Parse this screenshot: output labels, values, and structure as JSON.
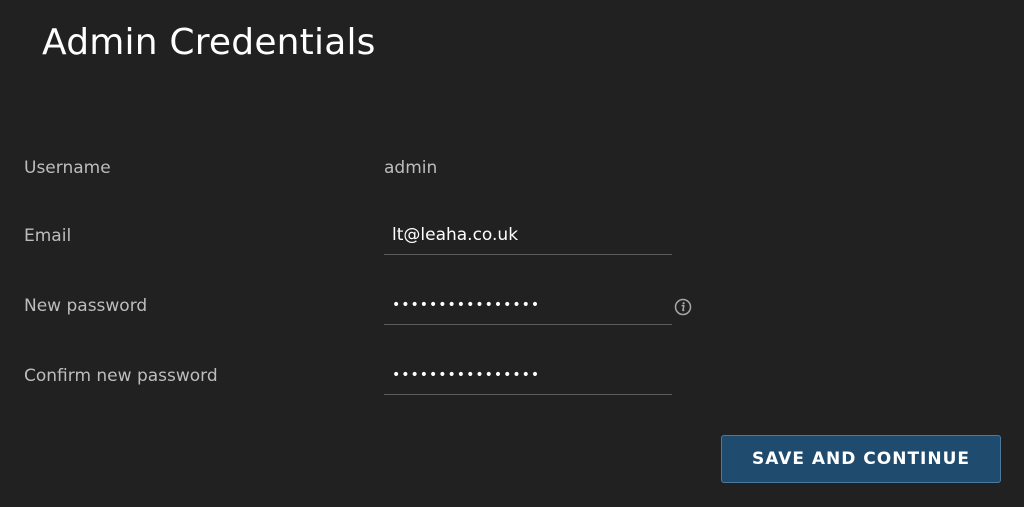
{
  "page": {
    "title": "Admin Credentials"
  },
  "form": {
    "username": {
      "label": "Username",
      "value": "admin"
    },
    "email": {
      "label": "Email",
      "value": "lt@leaha.co.uk"
    },
    "new_password": {
      "label": "New password",
      "value": "••••••••••••••••"
    },
    "confirm_password": {
      "label": "Confirm new password",
      "value": "••••••••••••••••"
    }
  },
  "actions": {
    "save_label": "SAVE AND CONTINUE"
  },
  "icons": {
    "password_hint": "info-icon"
  },
  "colors": {
    "background": "#212121",
    "button": "#1f4b6e",
    "button_border": "#4c7a9f"
  }
}
